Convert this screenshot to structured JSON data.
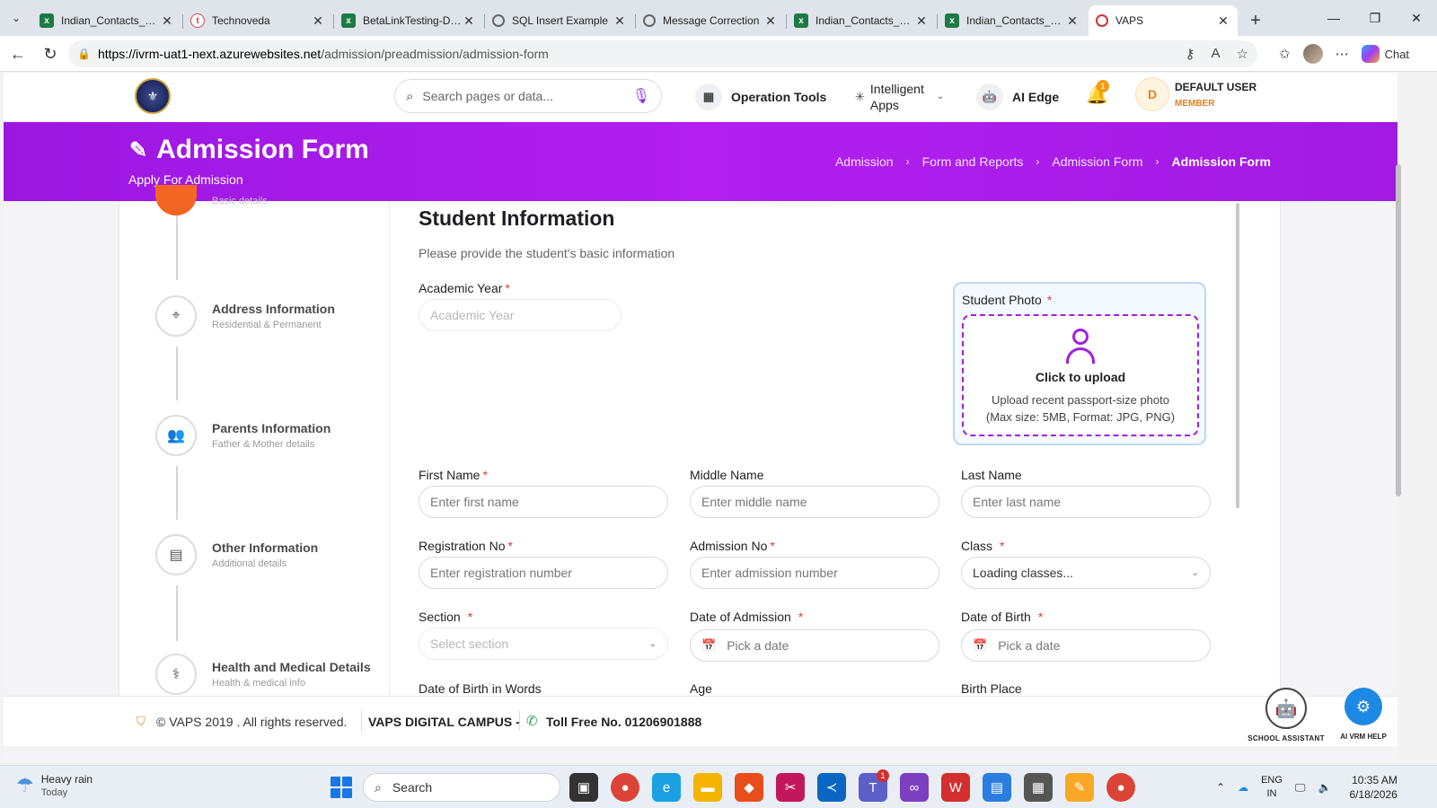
{
  "browser": {
    "tabs": [
      {
        "title": "Indian_Contacts_200...",
        "icon": "excel-icon",
        "active": false
      },
      {
        "title": "Technoveda",
        "icon": "technoveda-icon",
        "active": false
      },
      {
        "title": "BetaLinkTesting-Defe...",
        "icon": "excel-icon",
        "active": false
      },
      {
        "title": "SQL Insert Example",
        "icon": "web-icon",
        "active": false
      },
      {
        "title": "Message Correction",
        "icon": "web-icon",
        "active": false
      },
      {
        "title": "Indian_Contacts_200...",
        "icon": "excel-icon",
        "active": false
      },
      {
        "title": "Indian_Contacts_200...",
        "icon": "excel-icon",
        "active": false
      },
      {
        "title": "VAPS",
        "icon": "vaps-icon",
        "active": true
      }
    ],
    "url_host": "https://ivrm-uat1-next.azurewebsites.net",
    "url_path": "/admission/preadmission/admission-form",
    "chat_label": "Chat"
  },
  "header": {
    "search_placeholder": "Search pages or data...",
    "operation_tools": "Operation Tools",
    "intelligent_apps_line1": "Intelligent",
    "intelligent_apps_line2": "Apps",
    "ai_edge": "AI Edge",
    "notification_count": "1",
    "user_initial": "D",
    "user_name": "DEFAULT USER",
    "user_role": "MEMBER"
  },
  "banner": {
    "title": "Admission Form",
    "subtitle": "Apply For Admission",
    "breadcrumbs": [
      "Admission",
      "Form and Reports",
      "Admission Form",
      "Admission Form"
    ]
  },
  "stepper": {
    "previous_label": "Basic details",
    "steps": [
      {
        "title": "Address Information",
        "sub": "Residential & Permanent"
      },
      {
        "title": "Parents Information",
        "sub": "Father & Mother details"
      },
      {
        "title": "Other Information",
        "sub": "Additional details"
      },
      {
        "title": "Health and Medical Details",
        "sub": "Health & medical info"
      }
    ]
  },
  "form": {
    "title": "Student Information",
    "description": "Please provide the student's basic information",
    "academic_year_label": "Academic Year",
    "academic_year_placeholder": "Academic Year",
    "photo_label": "Student Photo",
    "photo_cta": "Click to upload",
    "photo_hint1": "Upload recent passport-size photo",
    "photo_hint2": "(Max size: 5MB, Format: JPG, PNG)",
    "first_name_label": "First Name",
    "first_name_placeholder": "Enter first name",
    "middle_name_label": "Middle Name",
    "middle_name_placeholder": "Enter middle name",
    "last_name_label": "Last Name",
    "last_name_placeholder": "Enter last name",
    "registration_label": "Registration No",
    "registration_placeholder": "Enter registration number",
    "admission_no_label": "Admission No",
    "admission_no_placeholder": "Enter admission number",
    "class_label": "Class",
    "class_value": "Loading classes...",
    "section_label": "Section",
    "section_placeholder": "Select section",
    "doa_label": "Date of Admission",
    "doa_placeholder": "Pick a date",
    "dob_label": "Date of Birth",
    "dob_placeholder": "Pick a date",
    "dob_words_label": "Date of Birth in Words",
    "age_label": "Age",
    "birth_place_label": "Birth Place",
    "required_mark": "*"
  },
  "footer": {
    "copyright": "© VAPS 2019 . All rights reserved.",
    "campus": "VAPS DIGITAL CAMPUS -",
    "toll_free": "Toll Free No. 01206901888",
    "school_assistant": "SCHOOL ASSISTANT",
    "ai_help": "AI VRM HELP"
  },
  "taskbar": {
    "weather_main": "Heavy rain",
    "weather_sub": "Today",
    "search_label": "Search",
    "teams_badge": "1",
    "lang_line1": "ENG",
    "lang_line2": "IN",
    "time": "10:35 AM",
    "date": "6/18/2026"
  },
  "colors": {
    "brand_purple": "#a11be3",
    "active_step": "#f26522",
    "required": "#e53935",
    "accent_orange": "#e67e22"
  }
}
